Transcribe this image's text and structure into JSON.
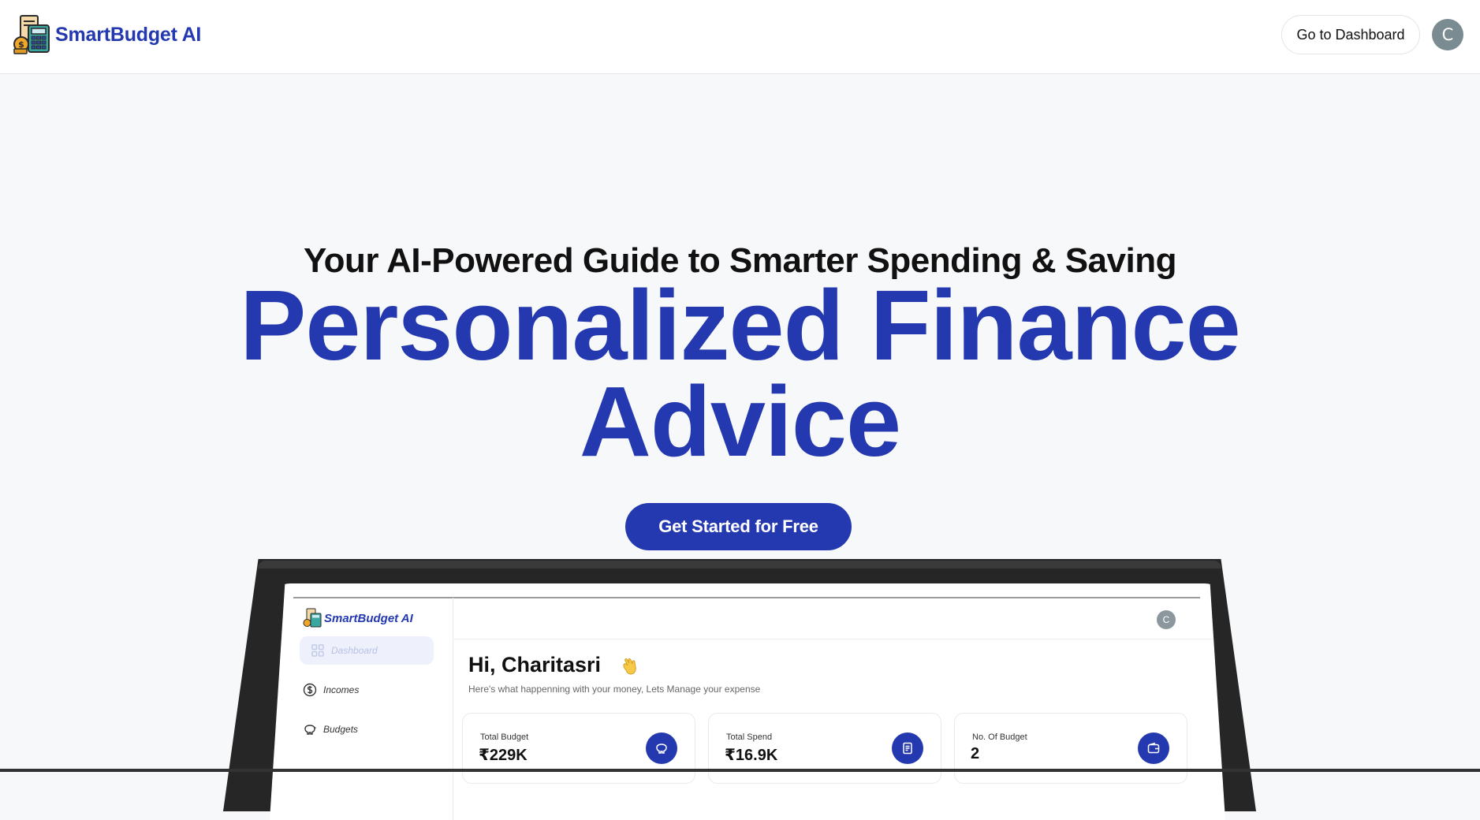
{
  "header": {
    "brand_name": "SmartBudget AI",
    "dashboard_button": "Go to Dashboard",
    "avatar_initial": "C"
  },
  "hero": {
    "tagline": "Your AI-Powered Guide to Smarter Spending & Saving",
    "headline_line1": "Personalized Finance",
    "headline_line2": "Advice",
    "cta_label": "Get Started for Free"
  },
  "preview": {
    "brand_name": "SmartBudget AI",
    "avatar_initial": "C",
    "sidebar": [
      {
        "label": "Dashboard",
        "icon": "grid-icon"
      },
      {
        "label": "Incomes",
        "icon": "dollar-circle-icon"
      },
      {
        "label": "Budgets",
        "icon": "piggy-bank-icon"
      }
    ],
    "greeting": "Hi, Charitasri",
    "subtitle": "Here's what happenning with your money, Lets Manage your expense",
    "cards": [
      {
        "label": "Total Budget",
        "value": "₹229K",
        "icon": "piggy-bank-icon"
      },
      {
        "label": "Total Spend",
        "value": "₹16.9K",
        "icon": "receipt-icon"
      },
      {
        "label": "No. Of Budget",
        "value": "2",
        "icon": "wallet-icon"
      }
    ]
  },
  "colors": {
    "brand": "#2439b0",
    "page_bg": "#f7f8fa",
    "device_frame": "#262626"
  }
}
